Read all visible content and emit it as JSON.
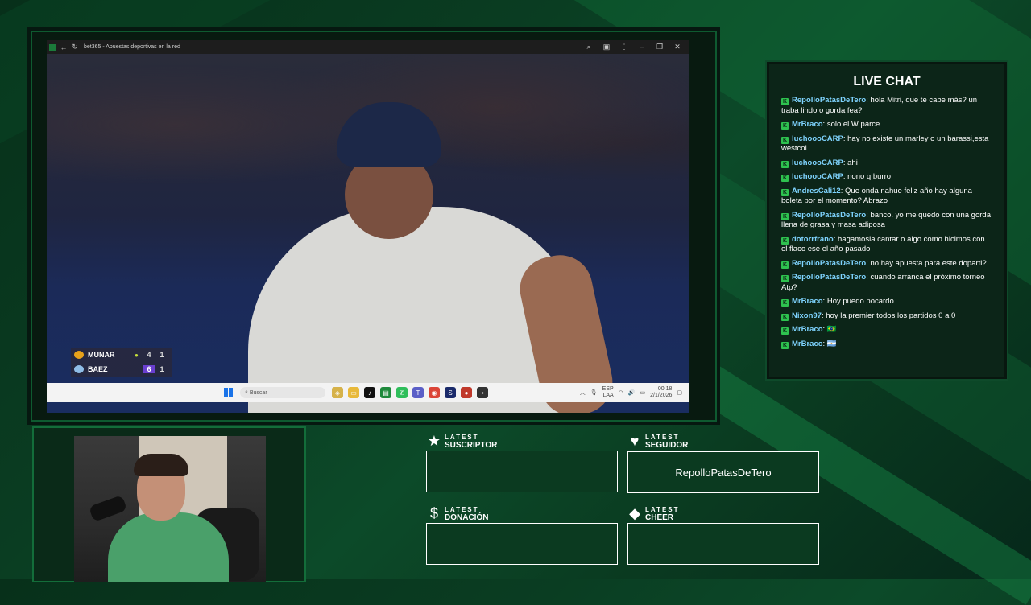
{
  "browser": {
    "title": "bet365 - Apuestas deportivas en la red",
    "controls": [
      "zoom",
      "extensions",
      "menu",
      "minimize",
      "restore",
      "close"
    ]
  },
  "scoreboard": {
    "players": [
      {
        "name": "MUNAR",
        "games1": "4",
        "games2": "1",
        "serving": true
      },
      {
        "name": "BAEZ",
        "games1": "6",
        "games2": "1",
        "serving": false
      }
    ]
  },
  "taskbar": {
    "search_placeholder": "Buscar",
    "lang_top": "ESP",
    "lang_bottom": "LAA",
    "time": "00:18",
    "date": "2/1/2026"
  },
  "chat": {
    "title": "LIVE CHAT",
    "messages": [
      {
        "user": "RepolloPatasDeTero",
        "text": "hola Mitri, que te cabe más? un traba lindo o gorda fea?"
      },
      {
        "user": "MrBraco",
        "text": "solo el W parce"
      },
      {
        "user": "luchoooCARP",
        "text": "hay no existe un marley o un barassi,esta westcol"
      },
      {
        "user": "luchoooCARP",
        "text": "ahi"
      },
      {
        "user": "luchoooCARP",
        "text": "nono q burro"
      },
      {
        "user": "AndresCali12",
        "text": "Que onda nahue feliz año hay alguna boleta por el momento? Abrazo"
      },
      {
        "user": "RepolloPatasDeTero",
        "text": "banco. yo me quedo con una gorda llena de grasa y masa adiposa"
      },
      {
        "user": "dotorrfrano",
        "text": "hagamosla cantar o algo como hicimos con el flaco ese el año pasado"
      },
      {
        "user": "RepolloPatasDeTero",
        "text": "no hay apuesta para este doparti?"
      },
      {
        "user": "RepolloPatasDeTero",
        "text": "cuando arranca el próximo torneo Atp?"
      },
      {
        "user": "MrBraco",
        "text": "Hoy puedo pocardo"
      },
      {
        "user": "Nixon97",
        "text": "hoy la premier todos los partidos 0 a 0"
      },
      {
        "user": "MrBraco",
        "text": "🇧🇷"
      },
      {
        "user": "MrBraco",
        "text": "🇦🇷"
      }
    ]
  },
  "latest": {
    "suscriptor": {
      "label1": "LATEST",
      "label2": "SUSCRIPTOR",
      "value": ""
    },
    "seguidor": {
      "label1": "LATEST",
      "label2": "SEGUIDOR",
      "value": "RepolloPatasDeTero"
    },
    "donacion": {
      "label1": "LATEST",
      "label2": "DONACIÓN",
      "value": ""
    },
    "cheer": {
      "label1": "LATEST",
      "label2": "CHEER",
      "value": ""
    }
  },
  "colors": {
    "accent": "#2ec24f",
    "username": "#7fd4ff",
    "background": "#0a3d22"
  }
}
